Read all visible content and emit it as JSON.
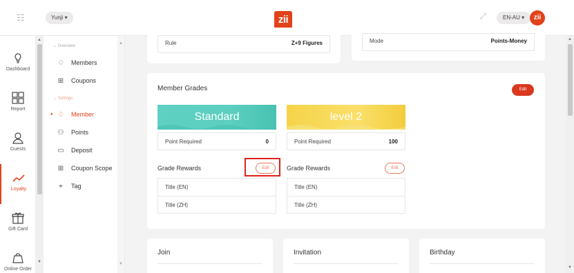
{
  "topbar": {
    "menu_icon": "menu-icon",
    "user": "Yunji",
    "logo": "zii",
    "fullscreen_icon": "fullscreen-icon",
    "lang": "EN-AU",
    "avatar": "zii"
  },
  "leftnav": [
    {
      "label": "Dashboard",
      "icon": "lightbulb-icon"
    },
    {
      "label": "Report",
      "icon": "grid-icon"
    },
    {
      "label": "Guests",
      "icon": "person-icon"
    },
    {
      "label": "Loyalty",
      "icon": "trend-icon"
    },
    {
      "label": "Gift Card",
      "icon": "gift-icon"
    },
    {
      "label": "Online Order",
      "icon": "bag-icon"
    }
  ],
  "submenu": {
    "overview": "Overview",
    "members": "Members",
    "coupons": "Coupons",
    "settings": "Settings",
    "member": "Member",
    "points": "Points",
    "deposit": "Deposit",
    "coupon_scope": "Coupon Scope",
    "tag": "Tag"
  },
  "top_cards": {
    "rule_label": "Rule",
    "rule_value": "Z+9 Figures",
    "mode_label": "Mode",
    "mode_value": "Points-Money"
  },
  "grades": {
    "title": "Member Grades",
    "edit": "Edit",
    "items": [
      {
        "name": "Standard",
        "point_label": "Point Required",
        "point_value": "0",
        "rewards": "Grade Rewards",
        "edit": "Edit",
        "title_en": "Title (EN)",
        "title_zh": "Title (ZH)"
      },
      {
        "name": "level 2",
        "point_label": "Point Required",
        "point_value": "100",
        "rewards": "Grade Rewards",
        "edit": "Edit",
        "title_en": "Title (EN)",
        "title_zh": "Title (ZH)"
      }
    ]
  },
  "bottom": {
    "join": "Join",
    "invitation": "Invitation",
    "birthday": "Birthday"
  },
  "colors": {
    "accent": "#e2421b",
    "teal": "#5ccfc0",
    "yellow": "#f5d449"
  }
}
